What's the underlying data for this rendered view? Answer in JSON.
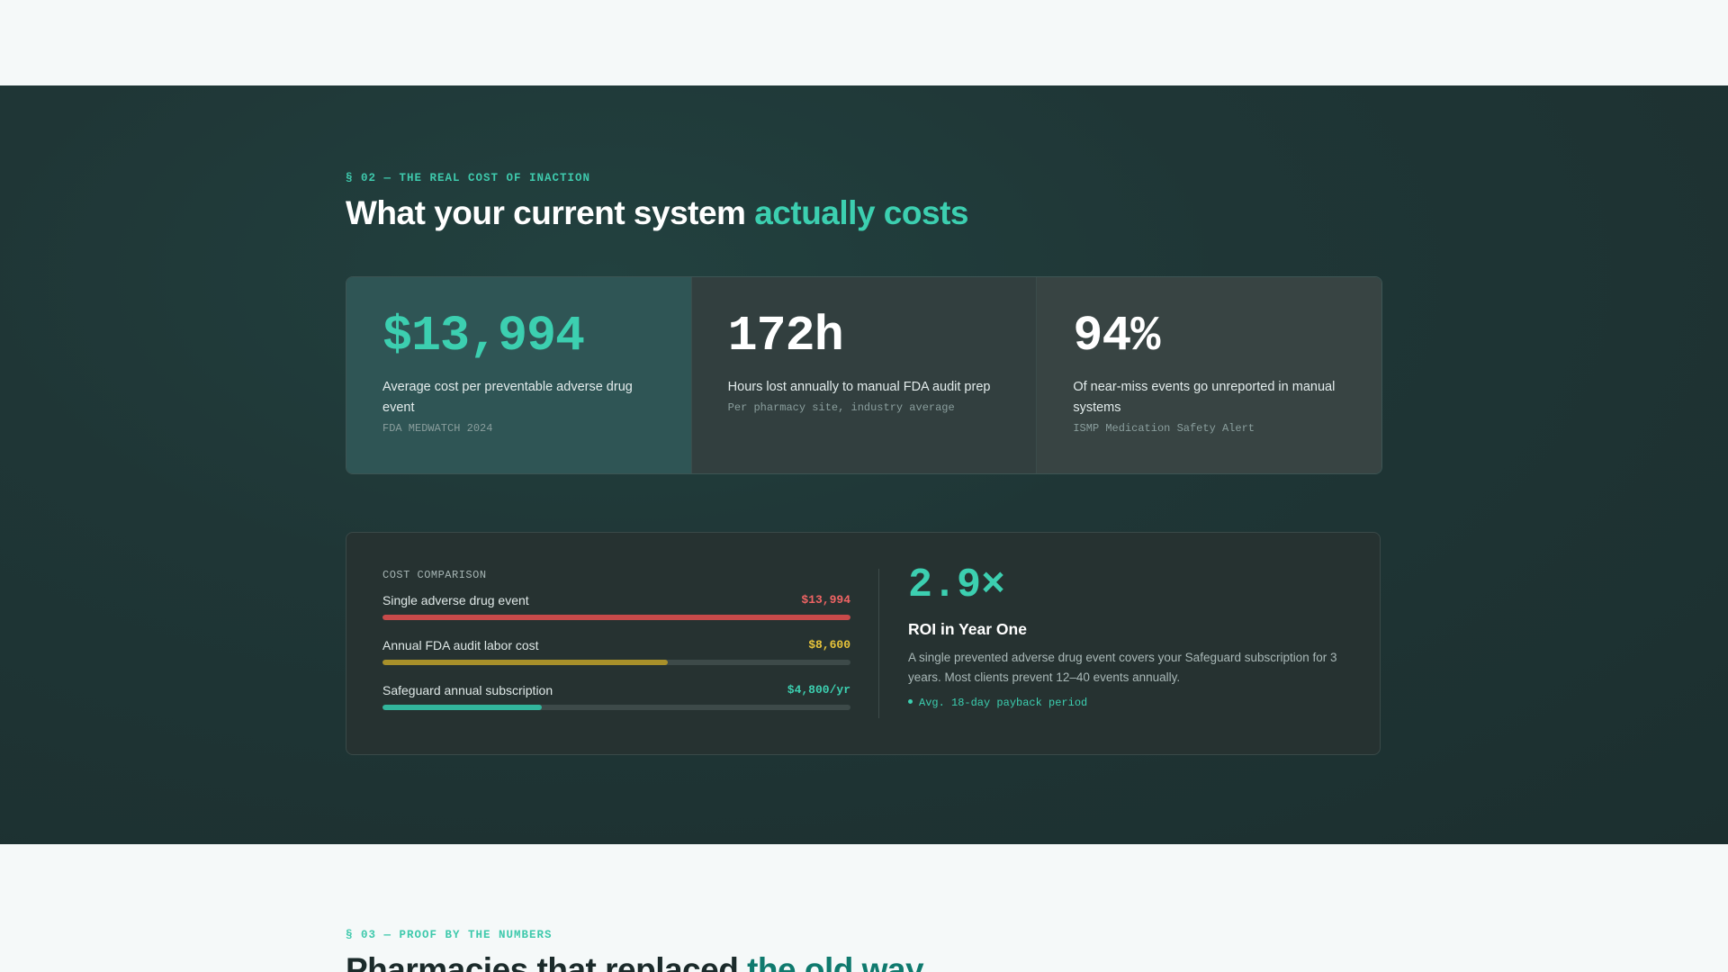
{
  "section_cost": {
    "eyebrow": "§ 02 — THE REAL COST OF INACTION",
    "title_main": "What your current system ",
    "title_accent": "actually costs",
    "stats": [
      {
        "value": "$13,994",
        "description": "Average cost per preventable adverse drug event",
        "source": "FDA MEDWATCH 2024"
      },
      {
        "value": "172h",
        "description": "Hours lost annually to manual FDA audit prep",
        "source": "Per pharmacy site, industry average"
      },
      {
        "value": "94%",
        "description": "Of near-miss events go unreported in manual systems",
        "source": "ISMP Medication Safety Alert"
      }
    ],
    "comparison": {
      "title": "COST COMPARISON",
      "bars": [
        {
          "label": "Single adverse drug event",
          "value": "$13,994",
          "fill": 1.0,
          "color": "#c84a4a",
          "value_color": "#f06464"
        },
        {
          "label": "Annual FDA audit labor cost",
          "value": "$8,600",
          "fill": 0.61,
          "color": "#a8902a",
          "value_color": "#e8c43a"
        },
        {
          "label": "Safeguard annual subscription",
          "value": "$4,800/yr",
          "fill": 0.34,
          "color": "#32b59c",
          "value_color": "#3ccfb0"
        }
      ]
    },
    "roi": {
      "value": "2.9×",
      "title": "ROI in Year One",
      "description": "A single prevented adverse drug event covers your Safeguard subscription for 3 years. Most clients prevent 12–40 events annually.",
      "note": "Avg. 18-day payback period"
    }
  },
  "section_proof": {
    "eyebrow": "§ 03 — PROOF BY THE NUMBERS",
    "title_main": "Pharmacies that replaced ",
    "title_accent": "the old way"
  }
}
